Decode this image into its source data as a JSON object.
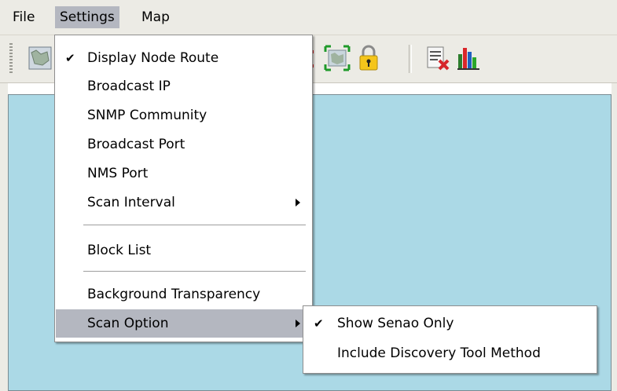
{
  "menubar": {
    "file": "File",
    "settings": "Settings",
    "map": "Map"
  },
  "toolbar": {
    "icons": [
      "map-icon",
      "fit-to-window-icon",
      "lock-icon",
      "clear-list-icon",
      "bar-chart-icon"
    ]
  },
  "settings_menu": {
    "display_node_route": {
      "label": "Display Node Route",
      "checked": "✔"
    },
    "broadcast_ip": "Broadcast IP",
    "snmp_community": "SNMP Community",
    "broadcast_port": "Broadcast Port",
    "nms_port": "NMS Port",
    "scan_interval": "Scan Interval",
    "block_list": "Block List",
    "background_transparency": "Background Transparency",
    "scan_option": "Scan Option"
  },
  "scan_option_submenu": {
    "show_senao_only": {
      "label": "Show Senao Only",
      "checked": "✔"
    },
    "include_discovery_tool_method": "Include Discovery Tool Method"
  },
  "colors": {
    "map_background": "#abd9e6",
    "menu_highlight": "#b4b7c0",
    "chrome": "#ecebe5"
  }
}
